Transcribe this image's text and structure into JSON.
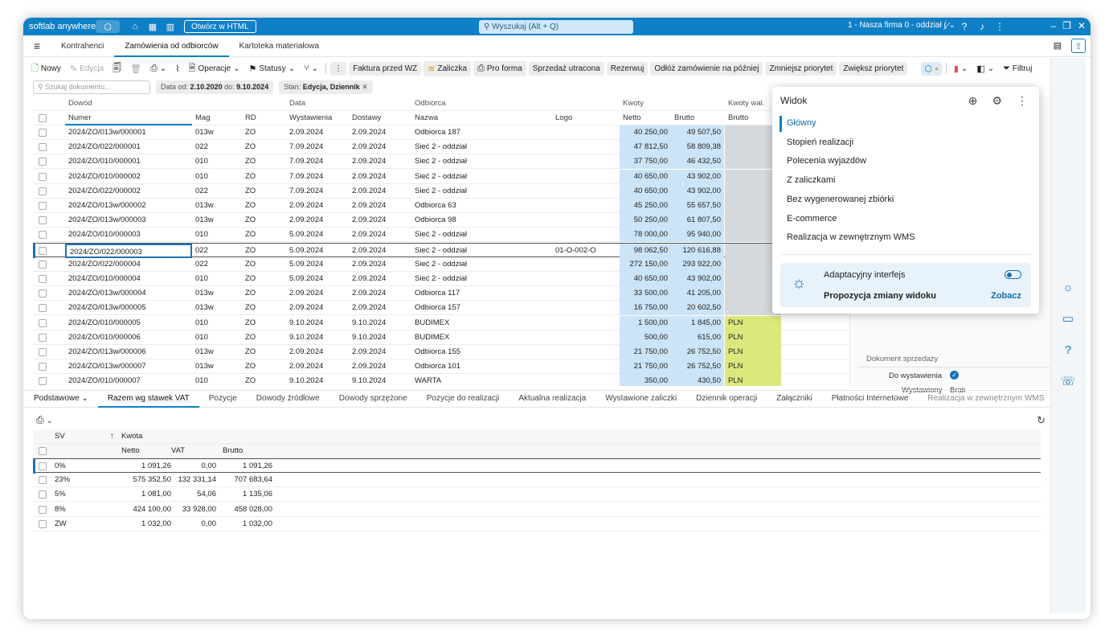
{
  "titlebar": {
    "brand": "softlab anywhere",
    "open_html_label": "Otwórz w HTML",
    "search_placeholder": "Wyszukaj (Alt + Q)",
    "company": "1 - Nasza firma 0 - oddział (",
    "icons": [
      "cube-icon",
      "home-icon",
      "grid-icon",
      "barcode-icon",
      "chevron-down-icon",
      "unlink-icon",
      "help-icon",
      "bell-icon",
      "more-icon",
      "minimize-icon",
      "restore-icon",
      "close-icon"
    ]
  },
  "app_tabs": [
    "Kontrahenci",
    "Zamówienia od odbiorców",
    "Kartoteka materiałowa"
  ],
  "toolbar": {
    "new": "Nowy",
    "edit": "Edycja",
    "operations": "Operacje",
    "statuses": "Statusy",
    "buttons": [
      "Faktura przed WZ",
      "Zaliczka",
      "Pro forma",
      "Sprzedaż utracona",
      "Rezerwuj",
      "Odłóż zamówienie na później",
      "Zmniejsz priorytet",
      "Zwiększ priorytet"
    ],
    "filter": "Filtruj"
  },
  "filter": {
    "search_placeholder": "Szukaj dokumentu...",
    "date_label": "Data",
    "date_from_label": "od:",
    "date_from": "2.10.2020",
    "date_to_label": "do:",
    "date_to": "9.10.2024",
    "state_label": "Stan:",
    "state_value": "Edycja, Dziennik"
  },
  "grid": {
    "group_headers": [
      "Dowód",
      "Data",
      "Odbiorca",
      "Kwoty",
      "Kwoty wal."
    ],
    "headers": [
      "Numer",
      "Mag",
      "RD",
      "Wystawienia",
      "Dostawy",
      "Nazwa",
      "Logo",
      "Netto",
      "Brutto",
      "Brutto"
    ],
    "rows": [
      [
        "2024/ZO/013w/000001",
        "013w",
        "ZO",
        "2.09.2024",
        "2.09.2024",
        "Odbiorca 187",
        "",
        "40 250,00",
        "49 507,50",
        ""
      ],
      [
        "2024/ZO/022/000001",
        "022",
        "ZO",
        "7.09.2024",
        "2.09.2024",
        "Sieć 2 - oddział",
        "",
        "47 812,50",
        "58 809,38",
        ""
      ],
      [
        "2024/ZO/010/000001",
        "010",
        "ZO",
        "7.09.2024",
        "2.09.2024",
        "Sieć 2 - oddział",
        "",
        "37 750,00",
        "46 432,50",
        ""
      ],
      [
        "2024/ZO/010/000002",
        "010",
        "ZO",
        "7.09.2024",
        "2.09.2024",
        "Sieć 2 - oddział",
        "",
        "40 650,00",
        "43 902,00",
        ""
      ],
      [
        "2024/ZO/022/000002",
        "022",
        "ZO",
        "7.09.2024",
        "2.09.2024",
        "Sieć 2 - oddział",
        "",
        "40 650,00",
        "43 902,00",
        ""
      ],
      [
        "2024/ZO/013w/000002",
        "013w",
        "ZO",
        "2.09.2024",
        "2.09.2024",
        "Odbiorca 63",
        "",
        "45 250,00",
        "55 657,50",
        ""
      ],
      [
        "2024/ZO/013w/000003",
        "013w",
        "ZO",
        "2.09.2024",
        "2.09.2024",
        "Odbiorca 98",
        "",
        "50 250,00",
        "61 807,50",
        ""
      ],
      [
        "2024/ZO/010/000003",
        "010",
        "ZO",
        "5.09.2024",
        "2.09.2024",
        "Sieć 2 - oddział",
        "",
        "78 000,00",
        "95 940,00",
        ""
      ],
      [
        "2024/ZO/022/000003",
        "022",
        "ZO",
        "5.09.2024",
        "2.09.2024",
        "Sieć 2 - oddział",
        "01-O-002-O",
        "98 062,50",
        "120 616,88",
        ""
      ],
      [
        "2024/ZO/022/000004",
        "022",
        "ZO",
        "5.09.2024",
        "2.09.2024",
        "Sieć 2 - oddział",
        "",
        "272 150,00",
        "293 922,00",
        ""
      ],
      [
        "2024/ZO/010/000004",
        "010",
        "ZO",
        "5.09.2024",
        "2.09.2024",
        "Sieć 2 - oddział",
        "",
        "40 650,00",
        "43 902,00",
        ""
      ],
      [
        "2024/ZO/013w/000004",
        "013w",
        "ZO",
        "2.09.2024",
        "2.09.2024",
        "Odbiorca 117",
        "",
        "33 500,00",
        "41 205,00",
        ""
      ],
      [
        "2024/ZO/013w/000005",
        "013w",
        "ZO",
        "2.09.2024",
        "2.09.2024",
        "Odbiorca 157",
        "",
        "16 750,00",
        "20 602,50",
        ""
      ],
      [
        "2024/ZO/010/000005",
        "010",
        "ZO",
        "9.10.2024",
        "9.10.2024",
        "BUDIMEX",
        "",
        "1 500,00",
        "1 845,00",
        "PLN"
      ],
      [
        "2024/ZO/010/000006",
        "010",
        "ZO",
        "9.10.2024",
        "9.10.2024",
        "BUDIMEX",
        "",
        "500,00",
        "615,00",
        "PLN"
      ],
      [
        "2024/ZO/013w/000006",
        "013w",
        "ZO",
        "2.09.2024",
        "2.09.2024",
        "Odbiorca 155",
        "",
        "21 750,00",
        "26 752,50",
        "PLN"
      ],
      [
        "2024/ZO/013w/000007",
        "013w",
        "ZO",
        "2.09.2024",
        "2.09.2024",
        "Odbiorca 101",
        "",
        "21 750,00",
        "26 752,50",
        "PLN"
      ],
      [
        "2024/ZO/010/000007",
        "010",
        "ZO",
        "9.10.2024",
        "9.10.2024",
        "WARTA",
        "",
        "350,00",
        "430,50",
        "PLN"
      ]
    ],
    "selected_row": 8
  },
  "side_panel": {
    "section_title": "Dokument sprzedaży",
    "to_issue_label": "Do wystawienia",
    "issued_label": "Wystawiony",
    "issued_value": "Brak"
  },
  "view_popup": {
    "title": "Widok",
    "items": [
      "Główny",
      "Stopień realizacji",
      "Polecenia wyjazdów",
      "Z zaliczkami",
      "Bez wygenerowanej zbiórki",
      "E-commerce",
      "Realizacja w zewnętrznym WMS"
    ],
    "active_index": 0,
    "adaptive_title": "Adaptacyjny interfejs",
    "proposal_label": "Propozycja zmiany widoku",
    "proposal_link": "Zobacz"
  },
  "lower_tabs": [
    "Podstawowe",
    "Razem wg stawek VAT",
    "Pozycje",
    "Dowody źródłowe",
    "Dowody sprzężone",
    "Pozycje do realizacji",
    "Aktualna realizacja",
    "Wystawione zaliczki",
    "Dziennik operacji",
    "Załączniki",
    "Płatności Internetowe",
    "Realizacja w zewnętrznym WMS"
  ],
  "vat_table": {
    "headers": {
      "sv": "SV",
      "kwota": "Kwota",
      "netto": "Netto",
      "vat": "VAT",
      "brutto": "Brutto"
    },
    "rows": [
      [
        "0%",
        "1 091,26",
        "0,00",
        "1 091,26"
      ],
      [
        "23%",
        "575 352,50",
        "132 331,14",
        "707 683,64"
      ],
      [
        "5%",
        "1 081,00",
        "54,06",
        "1 135,06"
      ],
      [
        "8%",
        "424 100,00",
        "33 928,00",
        "458 028,00"
      ],
      [
        "ZW",
        "1 032,00",
        "0,00",
        "1 032,00"
      ]
    ]
  },
  "colors": {
    "accent": "#0f80c6",
    "netto_bg": "#cce4f7",
    "currency_bg": "#dde87c",
    "kw_bg": "#d6d9dc"
  }
}
